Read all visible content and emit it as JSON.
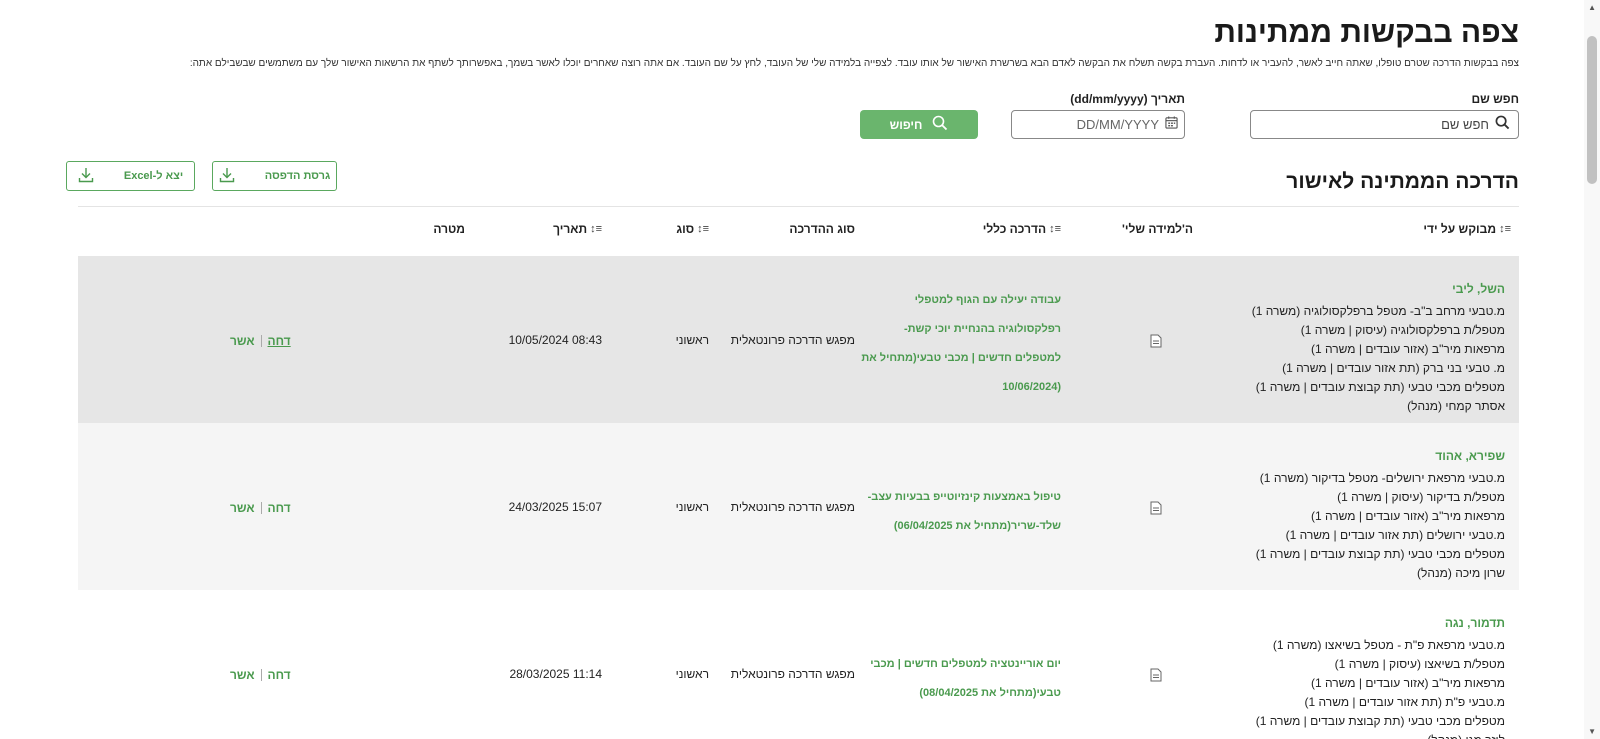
{
  "page": {
    "title": "צפה בבקשות ממתינות",
    "subtitle": "צפה בבקשות הדרכה שטרם טופלו, שאתה חייב לאשר, להעביר או לדחות. העברת בקשה תשלח את הבקשה לאדם הבא בשרשרת האישור של אותו עובד. לצפייה בלמידה שלי של העובד, לחץ על שם העובד. אם אתה רוצה שאחרים יוכלו לאשר בשמך, באפשרותך לשתף את הרשאות האישור שלך עם משתמשים שבשבילם אתה:"
  },
  "search": {
    "name_label": "חפש שם",
    "name_placeholder": "חפש שם",
    "date_label": "תאריך (dd/mm/yyyy)",
    "date_placeholder": "DD/MM/YYYY",
    "search_button": "חיפוש"
  },
  "section": {
    "title": "הדרכה הממתינה לאישור",
    "print_button": "גרסת הדפסה",
    "excel_button": "יצא ל-Excel"
  },
  "table": {
    "headers": {
      "requested_by": "מבוקש על ידי",
      "my_learning": "ה'למידה שלי'",
      "course": "הדרכה כללי",
      "training_type": "סוג ההדרכה",
      "kind": "סוג",
      "date": "תאריך",
      "target": "מטרה"
    },
    "rows": [
      {
        "name": "השל, ליבי",
        "details": [
          "מ.טבעי מרחב ב\"ב- מטפל ברפלקסולוגיה (משרה 1)",
          "מטפל/ת ברפלקסולוגיה (עיסוק | משרה 1)",
          "מרפאות מיר\"ב (אזור עובדים | משרה 1)",
          "מ. טבעי בני ברק (תת אזור עובדים | משרה 1)",
          "מטפלים מכבי טבעי (תת קבוצת עובדים | משרה 1)",
          "אסתר קמחי (מנהל)"
        ],
        "course_lines": [
          "עבודה יעילה עם הגוף למטפלי",
          "רפלקסולוגיה בהנחיית יוכי קשת-",
          "למטפלים חדשים | מכבי טבעי(מתחיל את",
          "(10/06/2024"
        ],
        "training_type": "מפגש הדרכה פרונטאלית",
        "kind": "ראשוני",
        "date": "08:43 10/05/2024",
        "approve": "אשר",
        "reject": "דחה"
      },
      {
        "name": "שפירא, אהוד",
        "details": [
          "מ.טבעי מרפאת ירושלים- מטפל בדיקור (משרה 1)",
          "מטפל/ת בדיקור (עיסוק | משרה 1)",
          "מרפאות מיר\"ב (אזור עובדים | משרה 1)",
          "מ.טבעי ירושלים (תת אזור עובדים | משרה 1)",
          "מטפלים מכבי טבעי (תת קבוצת עובדים | משרה 1)",
          "שרון מיכה (מנהל)"
        ],
        "course_lines": [
          "טיפול באמצעות קינזיוטייפ בבעיות עצב-",
          "שלד-שריר(מתחיל את 06/04/2025)"
        ],
        "training_type": "מפגש הדרכה פרונטאלית",
        "kind": "ראשוני",
        "date": "15:07 24/03/2025",
        "approve": "אשר",
        "reject": "דחה"
      },
      {
        "name": "תדמור, נגה",
        "details": [
          "מ.טבעי מרפאת פ\"ת - מטפל בשיאצו (משרה 1)",
          "מטפל/ת בשיאצו (עיסוק | משרה 1)",
          "מרפאות מיר\"ב (אזור עובדים | משרה 1)",
          "מ.טבעי פ\"ת (תת אזור עובדים | משרה 1)",
          "מטפלים מכבי טבעי (תת קבוצת עובדים | משרה 1)",
          "לוזר מגן (מנהל)"
        ],
        "course_lines": [
          "יום אוריינטציה למטפלים חדשים | מכבי",
          "טבעי(מתחיל את 08/04/2025)"
        ],
        "training_type": "מפגש הדרכה פרונטאלית",
        "kind": "ראשוני",
        "date": "11:14 28/03/2025",
        "approve": "אשר",
        "reject": "דחה"
      }
    ]
  },
  "colors": {
    "accent": "#6ab56d",
    "link": "#4a9a4e"
  }
}
